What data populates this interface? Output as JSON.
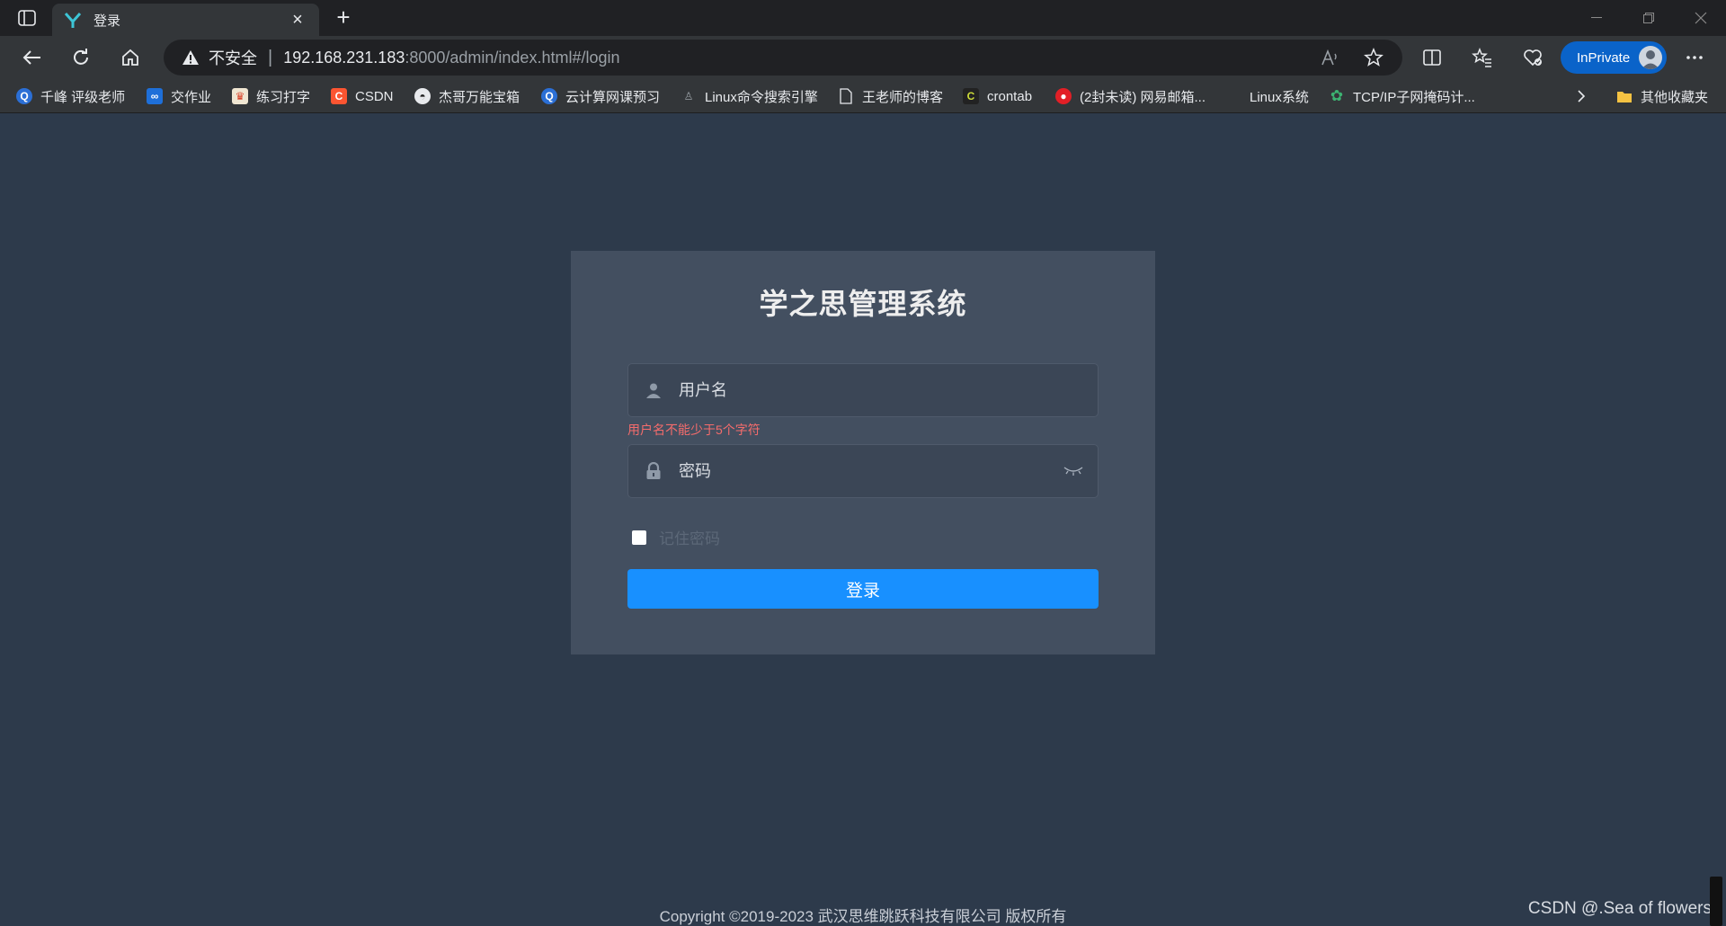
{
  "browser": {
    "tab_title": "登录",
    "security_label": "不安全",
    "url_host": "192.168.231.183",
    "url_path": ":8000/admin/index.html#/login",
    "inprivate_label": "InPrivate"
  },
  "bookmarks": [
    {
      "label": "千峰 评级老师",
      "icon": "qf-icon",
      "color": "#2b6fd6"
    },
    {
      "label": "交作业",
      "icon": "hw-icon",
      "color": "#1e6fd9"
    },
    {
      "label": "练习打字",
      "icon": "typing-icon",
      "color": "#d9442b"
    },
    {
      "label": "CSDN",
      "icon": "csdn-icon",
      "color": "#fc5531"
    },
    {
      "label": "杰哥万能宝箱",
      "icon": "jg-icon",
      "color": "#444444"
    },
    {
      "label": "云计算网课预习",
      "icon": "cloud-icon",
      "color": "#2b6fd6"
    },
    {
      "label": "Linux命令搜索引擎",
      "icon": "linux-icon",
      "color": "#555555"
    },
    {
      "label": "王老师的博客",
      "icon": "page-icon",
      "color": "#333639"
    },
    {
      "label": "crontab",
      "icon": "crontab-icon",
      "color": "#cddc39"
    },
    {
      "label": "(2封未读) 网易邮箱...",
      "icon": "mail-icon",
      "color": "#e21f26"
    },
    {
      "label": "Linux系统",
      "icon": "",
      "color": ""
    },
    {
      "label": "TCP/IP子网掩码计...",
      "icon": "gear-icon",
      "color": "#3cb371"
    },
    {
      "label": "其他收藏夹",
      "icon": "folder-icon",
      "color": "#f5c242"
    }
  ],
  "login": {
    "title": "学之思管理系统",
    "username_placeholder": "用户名",
    "username_error": "用户名不能少于5个字符",
    "password_placeholder": "密码",
    "remember_label": "记住密码",
    "submit_label": "登录"
  },
  "footer": {
    "copyright": "Copyright ©2019-2023 武汉思维跳跃科技有限公司 版权所有",
    "watermark": "CSDN @.Sea of flowers"
  },
  "colors": {
    "page_bg": "#2d3a4b",
    "card_bg": "#434f60",
    "primary": "#1890ff",
    "error": "#f56c6c"
  }
}
